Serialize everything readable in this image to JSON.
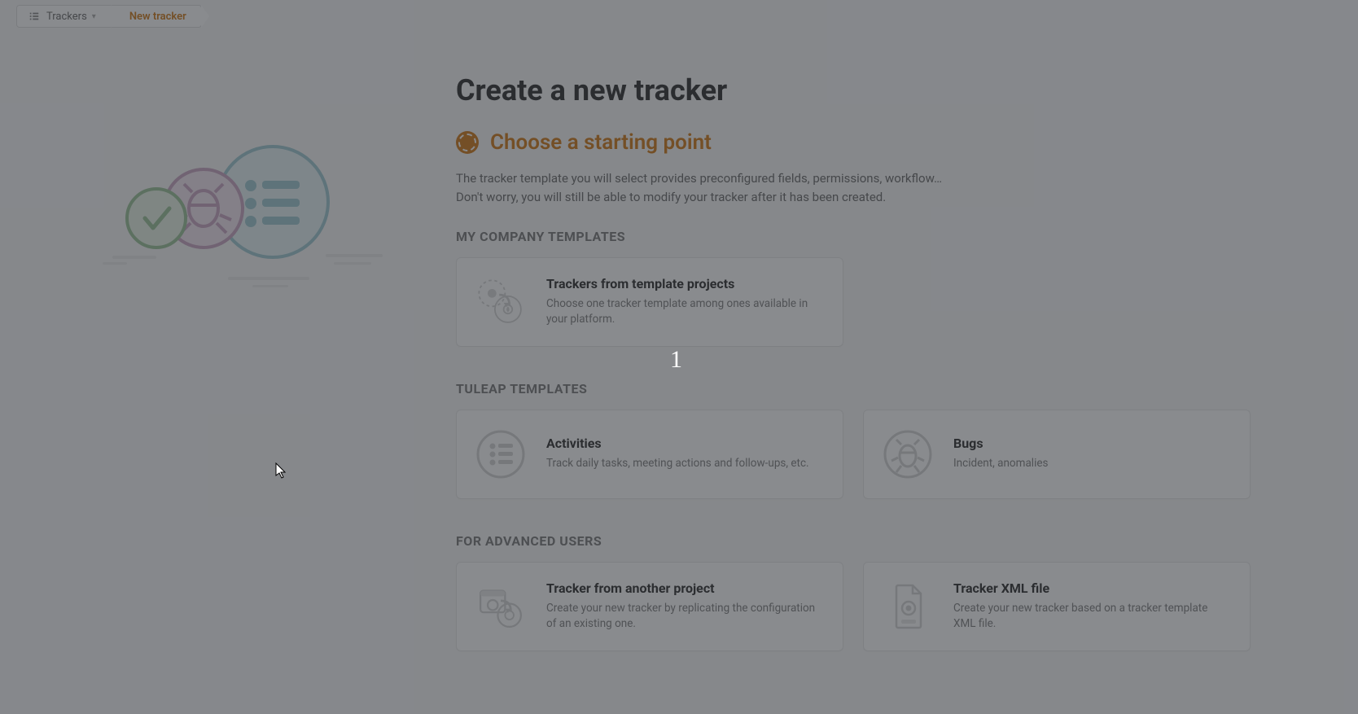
{
  "breadcrumb": {
    "trackers": "Trackers",
    "new": "New tracker"
  },
  "page": {
    "title": "Create a new tracker",
    "step_title": "Choose a starting point",
    "intro1": "The tracker template you will select provides preconfigured fields, permissions, workflow…",
    "intro2": "Don't worry, you will still be able to modify your tracker after it has been created."
  },
  "sections": {
    "company": {
      "heading": "MY COMPANY TEMPLATES",
      "card": {
        "title": "Trackers from template projects",
        "desc": "Choose one tracker template among ones available in your platform."
      }
    },
    "tuleap": {
      "heading": "TULEAP TEMPLATES",
      "cards": {
        "activities": {
          "title": "Activities",
          "desc": "Track daily tasks, meeting actions and follow-ups, etc."
        },
        "bugs": {
          "title": "Bugs",
          "desc": "Incident, anomalies"
        }
      }
    },
    "advanced": {
      "heading": "FOR ADVANCED USERS",
      "cards": {
        "another": {
          "title": "Tracker from another project",
          "desc": "Create your new tracker by replicating the configuration of an existing one."
        },
        "xml": {
          "title": "Tracker XML file",
          "desc": "Create your new tracker based on a tracker template XML file."
        }
      }
    }
  },
  "overlay": {
    "step_number": "1"
  }
}
